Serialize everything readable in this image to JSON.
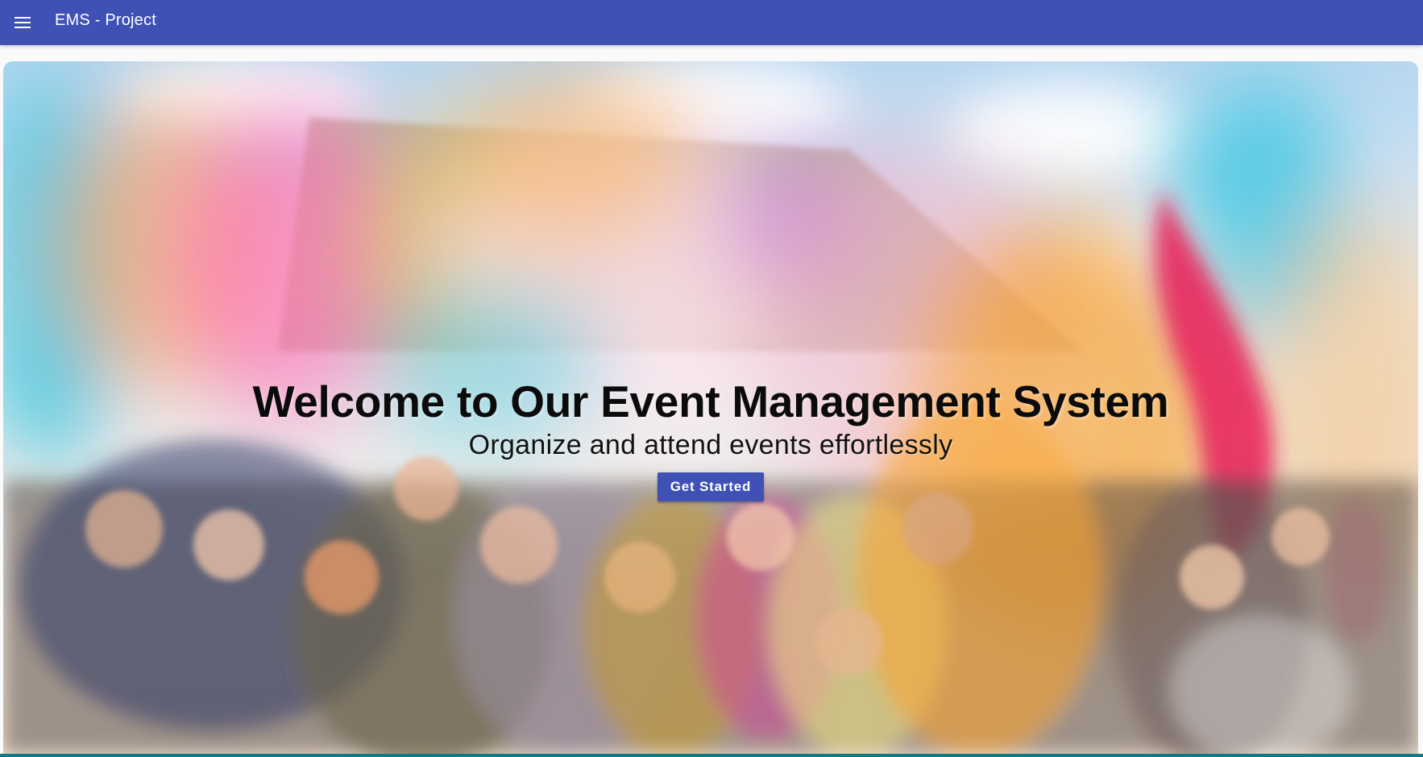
{
  "toolbar": {
    "menu_icon": "menu-icon",
    "title": "EMS - Project",
    "background": "#3f51b5"
  },
  "hero": {
    "image_description_icon": "festival-color-powder-photo",
    "title": "Welcome to Our Event Management System",
    "subtitle": "Organize and attend events effortlessly",
    "cta_label": "Get Started",
    "cta_color": "#3f51b5"
  }
}
